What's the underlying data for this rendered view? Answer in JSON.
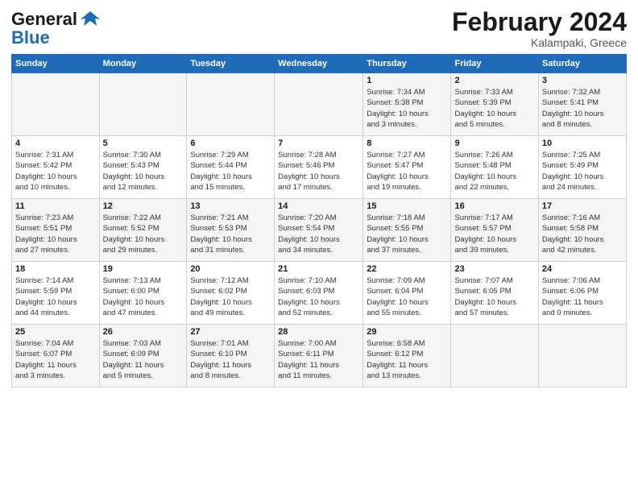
{
  "logo": {
    "general": "General",
    "blue": "Blue"
  },
  "header": {
    "month": "February 2024",
    "location": "Kalampaki, Greece"
  },
  "days_of_week": [
    "Sunday",
    "Monday",
    "Tuesday",
    "Wednesday",
    "Thursday",
    "Friday",
    "Saturday"
  ],
  "weeks": [
    [
      {
        "day": "",
        "info": ""
      },
      {
        "day": "",
        "info": ""
      },
      {
        "day": "",
        "info": ""
      },
      {
        "day": "",
        "info": ""
      },
      {
        "day": "1",
        "info": "Sunrise: 7:34 AM\nSunset: 5:38 PM\nDaylight: 10 hours\nand 3 minutes."
      },
      {
        "day": "2",
        "info": "Sunrise: 7:33 AM\nSunset: 5:39 PM\nDaylight: 10 hours\nand 5 minutes."
      },
      {
        "day": "3",
        "info": "Sunrise: 7:32 AM\nSunset: 5:41 PM\nDaylight: 10 hours\nand 8 minutes."
      }
    ],
    [
      {
        "day": "4",
        "info": "Sunrise: 7:31 AM\nSunset: 5:42 PM\nDaylight: 10 hours\nand 10 minutes."
      },
      {
        "day": "5",
        "info": "Sunrise: 7:30 AM\nSunset: 5:43 PM\nDaylight: 10 hours\nand 12 minutes."
      },
      {
        "day": "6",
        "info": "Sunrise: 7:29 AM\nSunset: 5:44 PM\nDaylight: 10 hours\nand 15 minutes."
      },
      {
        "day": "7",
        "info": "Sunrise: 7:28 AM\nSunset: 5:46 PM\nDaylight: 10 hours\nand 17 minutes."
      },
      {
        "day": "8",
        "info": "Sunrise: 7:27 AM\nSunset: 5:47 PM\nDaylight: 10 hours\nand 19 minutes."
      },
      {
        "day": "9",
        "info": "Sunrise: 7:26 AM\nSunset: 5:48 PM\nDaylight: 10 hours\nand 22 minutes."
      },
      {
        "day": "10",
        "info": "Sunrise: 7:25 AM\nSunset: 5:49 PM\nDaylight: 10 hours\nand 24 minutes."
      }
    ],
    [
      {
        "day": "11",
        "info": "Sunrise: 7:23 AM\nSunset: 5:51 PM\nDaylight: 10 hours\nand 27 minutes."
      },
      {
        "day": "12",
        "info": "Sunrise: 7:22 AM\nSunset: 5:52 PM\nDaylight: 10 hours\nand 29 minutes."
      },
      {
        "day": "13",
        "info": "Sunrise: 7:21 AM\nSunset: 5:53 PM\nDaylight: 10 hours\nand 31 minutes."
      },
      {
        "day": "14",
        "info": "Sunrise: 7:20 AM\nSunset: 5:54 PM\nDaylight: 10 hours\nand 34 minutes."
      },
      {
        "day": "15",
        "info": "Sunrise: 7:18 AM\nSunset: 5:55 PM\nDaylight: 10 hours\nand 37 minutes."
      },
      {
        "day": "16",
        "info": "Sunrise: 7:17 AM\nSunset: 5:57 PM\nDaylight: 10 hours\nand 39 minutes."
      },
      {
        "day": "17",
        "info": "Sunrise: 7:16 AM\nSunset: 5:58 PM\nDaylight: 10 hours\nand 42 minutes."
      }
    ],
    [
      {
        "day": "18",
        "info": "Sunrise: 7:14 AM\nSunset: 5:59 PM\nDaylight: 10 hours\nand 44 minutes."
      },
      {
        "day": "19",
        "info": "Sunrise: 7:13 AM\nSunset: 6:00 PM\nDaylight: 10 hours\nand 47 minutes."
      },
      {
        "day": "20",
        "info": "Sunrise: 7:12 AM\nSunset: 6:02 PM\nDaylight: 10 hours\nand 49 minutes."
      },
      {
        "day": "21",
        "info": "Sunrise: 7:10 AM\nSunset: 6:03 PM\nDaylight: 10 hours\nand 52 minutes."
      },
      {
        "day": "22",
        "info": "Sunrise: 7:09 AM\nSunset: 6:04 PM\nDaylight: 10 hours\nand 55 minutes."
      },
      {
        "day": "23",
        "info": "Sunrise: 7:07 AM\nSunset: 6:05 PM\nDaylight: 10 hours\nand 57 minutes."
      },
      {
        "day": "24",
        "info": "Sunrise: 7:06 AM\nSunset: 6:06 PM\nDaylight: 11 hours\nand 0 minutes."
      }
    ],
    [
      {
        "day": "25",
        "info": "Sunrise: 7:04 AM\nSunset: 6:07 PM\nDaylight: 11 hours\nand 3 minutes."
      },
      {
        "day": "26",
        "info": "Sunrise: 7:03 AM\nSunset: 6:09 PM\nDaylight: 11 hours\nand 5 minutes."
      },
      {
        "day": "27",
        "info": "Sunrise: 7:01 AM\nSunset: 6:10 PM\nDaylight: 11 hours\nand 8 minutes."
      },
      {
        "day": "28",
        "info": "Sunrise: 7:00 AM\nSunset: 6:11 PM\nDaylight: 11 hours\nand 11 minutes."
      },
      {
        "day": "29",
        "info": "Sunrise: 6:58 AM\nSunset: 6:12 PM\nDaylight: 11 hours\nand 13 minutes."
      },
      {
        "day": "",
        "info": ""
      },
      {
        "day": "",
        "info": ""
      }
    ]
  ]
}
